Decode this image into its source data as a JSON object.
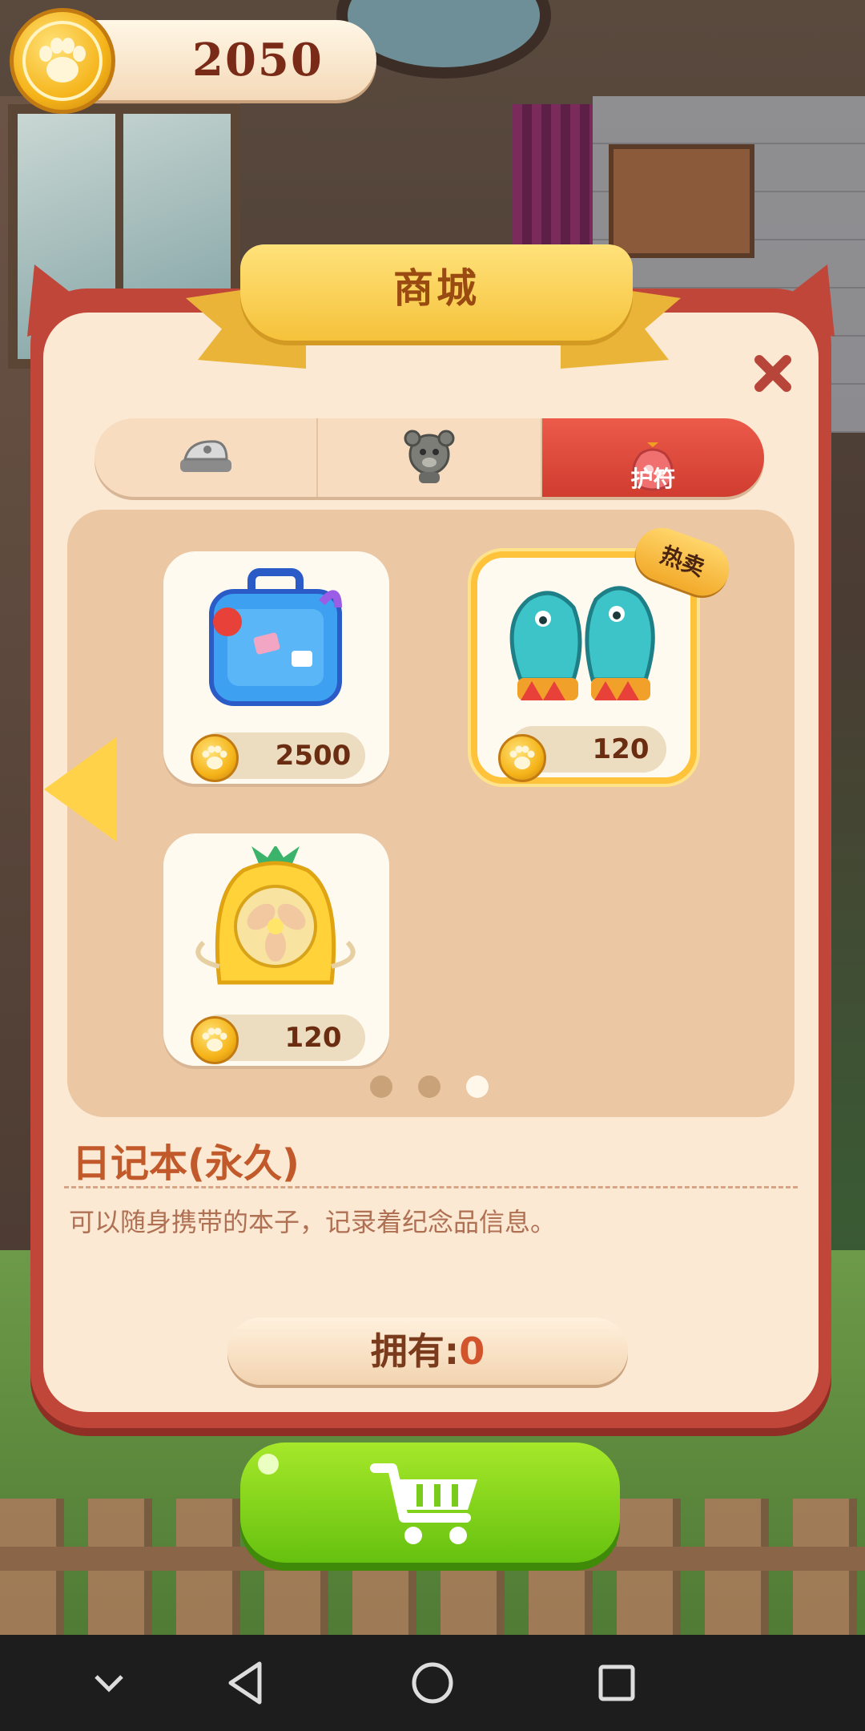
{
  "hud": {
    "coins": "2050"
  },
  "shop": {
    "title": "商城",
    "tabs": [
      {
        "label": "",
        "icon": "steam-iron-icon"
      },
      {
        "label": "",
        "icon": "bear-toy-icon"
      },
      {
        "label": "护符",
        "icon": "charm-bag-icon",
        "active": true
      }
    ],
    "items": [
      {
        "icon": "suitcase-icon",
        "price": "2500",
        "hot": false
      },
      {
        "icon": "mittens-icon",
        "price": "120",
        "hot": true,
        "badge": "热卖"
      },
      {
        "icon": "pineapple-fan-icon",
        "price": "120",
        "hot": false
      }
    ],
    "page_dots": {
      "count": 3,
      "active": 2
    },
    "description": {
      "title": "日记本(永久)",
      "text": "可以随身携带的本子，记录着纪念品信息。"
    },
    "owned": {
      "label": "拥有:",
      "value": "0"
    }
  },
  "colors": {
    "accent_red": "#c0463a",
    "active_tab": "#e04a3b",
    "buy_green": "#7ed321",
    "coin_gold": "#f5b41a"
  }
}
